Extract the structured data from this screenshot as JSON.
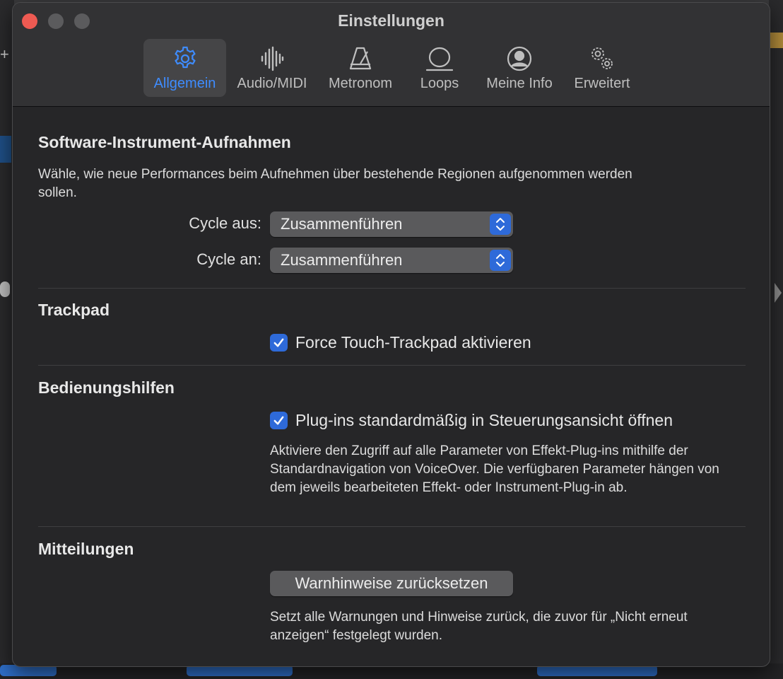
{
  "window": {
    "title": "Einstellungen"
  },
  "tabs": [
    {
      "label": "Allgemein",
      "icon": "gear-icon",
      "active": true
    },
    {
      "label": "Audio/MIDI",
      "icon": "waveform-icon",
      "active": false
    },
    {
      "label": "Metronom",
      "icon": "metronome-icon",
      "active": false
    },
    {
      "label": "Loops",
      "icon": "loop-icon",
      "active": false
    },
    {
      "label": "Meine Info",
      "icon": "person-icon",
      "active": false
    },
    {
      "label": "Erweitert",
      "icon": "gears-icon",
      "active": false
    }
  ],
  "software_instrument": {
    "title": "Software-Instrument-Aufnahmen",
    "description": "Wähle, wie neue Performances beim Aufnehmen über bestehende Regionen aufgenommen werden sollen.",
    "cycle_off": {
      "label": "Cycle aus:",
      "value": "Zusammenführen"
    },
    "cycle_on": {
      "label": "Cycle an:",
      "value": "Zusammenführen"
    }
  },
  "trackpad": {
    "title": "Trackpad",
    "force_touch": {
      "label": "Force Touch-Trackpad aktivieren",
      "checked": true
    }
  },
  "accessibility": {
    "title": "Bedienungshilfen",
    "plugins": {
      "label": "Plug-ins standardmäßig in Steuerungsansicht öffnen",
      "checked": true
    },
    "description": "Aktiviere den Zugriff auf alle Parameter von Effekt-Plug-ins mithilfe der Standardnavigation von VoiceOver. Die verfügbaren Parameter hängen von dem jeweils bearbeiteten Effekt- oder Instrument-Plug-in ab."
  },
  "notifications": {
    "title": "Mitteilungen",
    "reset_button": "Warnhinweise zurücksetzen",
    "description": "Setzt alle Warnungen und Hinweise zurück, die zuvor für „Nicht erneut anzeigen“ festgelegt wurden."
  },
  "colors": {
    "accent": "#2e6ad9",
    "active_tab_text": "#3e8cff",
    "close_button": "#ee5a52"
  }
}
